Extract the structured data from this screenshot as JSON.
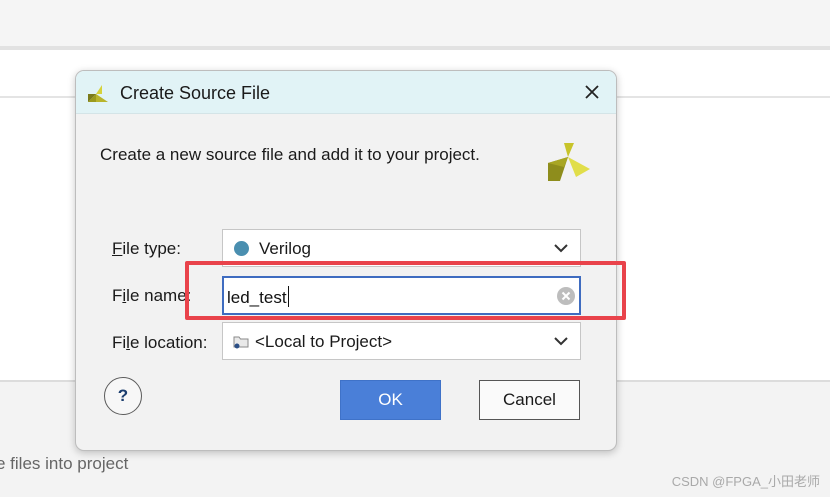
{
  "background": {
    "hint_text": "e files into project",
    "watermark": "CSDN @FPGA_小田老师"
  },
  "dialog": {
    "title": "Create Source File",
    "icons": {
      "app": "vivado-logo-icon",
      "close": "close-icon"
    },
    "intro": "Create a new source file and add it to your project.",
    "fields": {
      "file_type": {
        "label_prefix": "",
        "label_mnemonic": "F",
        "label_rest": "ile type:",
        "value": "Verilog",
        "icon": "verilog-dot-icon"
      },
      "file_name": {
        "label_prefix": "F",
        "label_mnemonic": "i",
        "label_rest": "le name:",
        "value": "led_test",
        "icon": "clear-icon"
      },
      "file_location": {
        "label_prefix": "Fi",
        "label_mnemonic": "l",
        "label_rest": "e location:",
        "value": "<Local to Project>",
        "icon": "folder-icon"
      }
    },
    "buttons": {
      "help": "?",
      "ok": "OK",
      "cancel": "Cancel"
    }
  },
  "colors": {
    "title_bar": "#e1f3f6",
    "ok_button": "#4a7fd8",
    "highlight": "#e9434b",
    "verilog_dot": "#4a8fb0",
    "logo": "#c8c42a"
  }
}
